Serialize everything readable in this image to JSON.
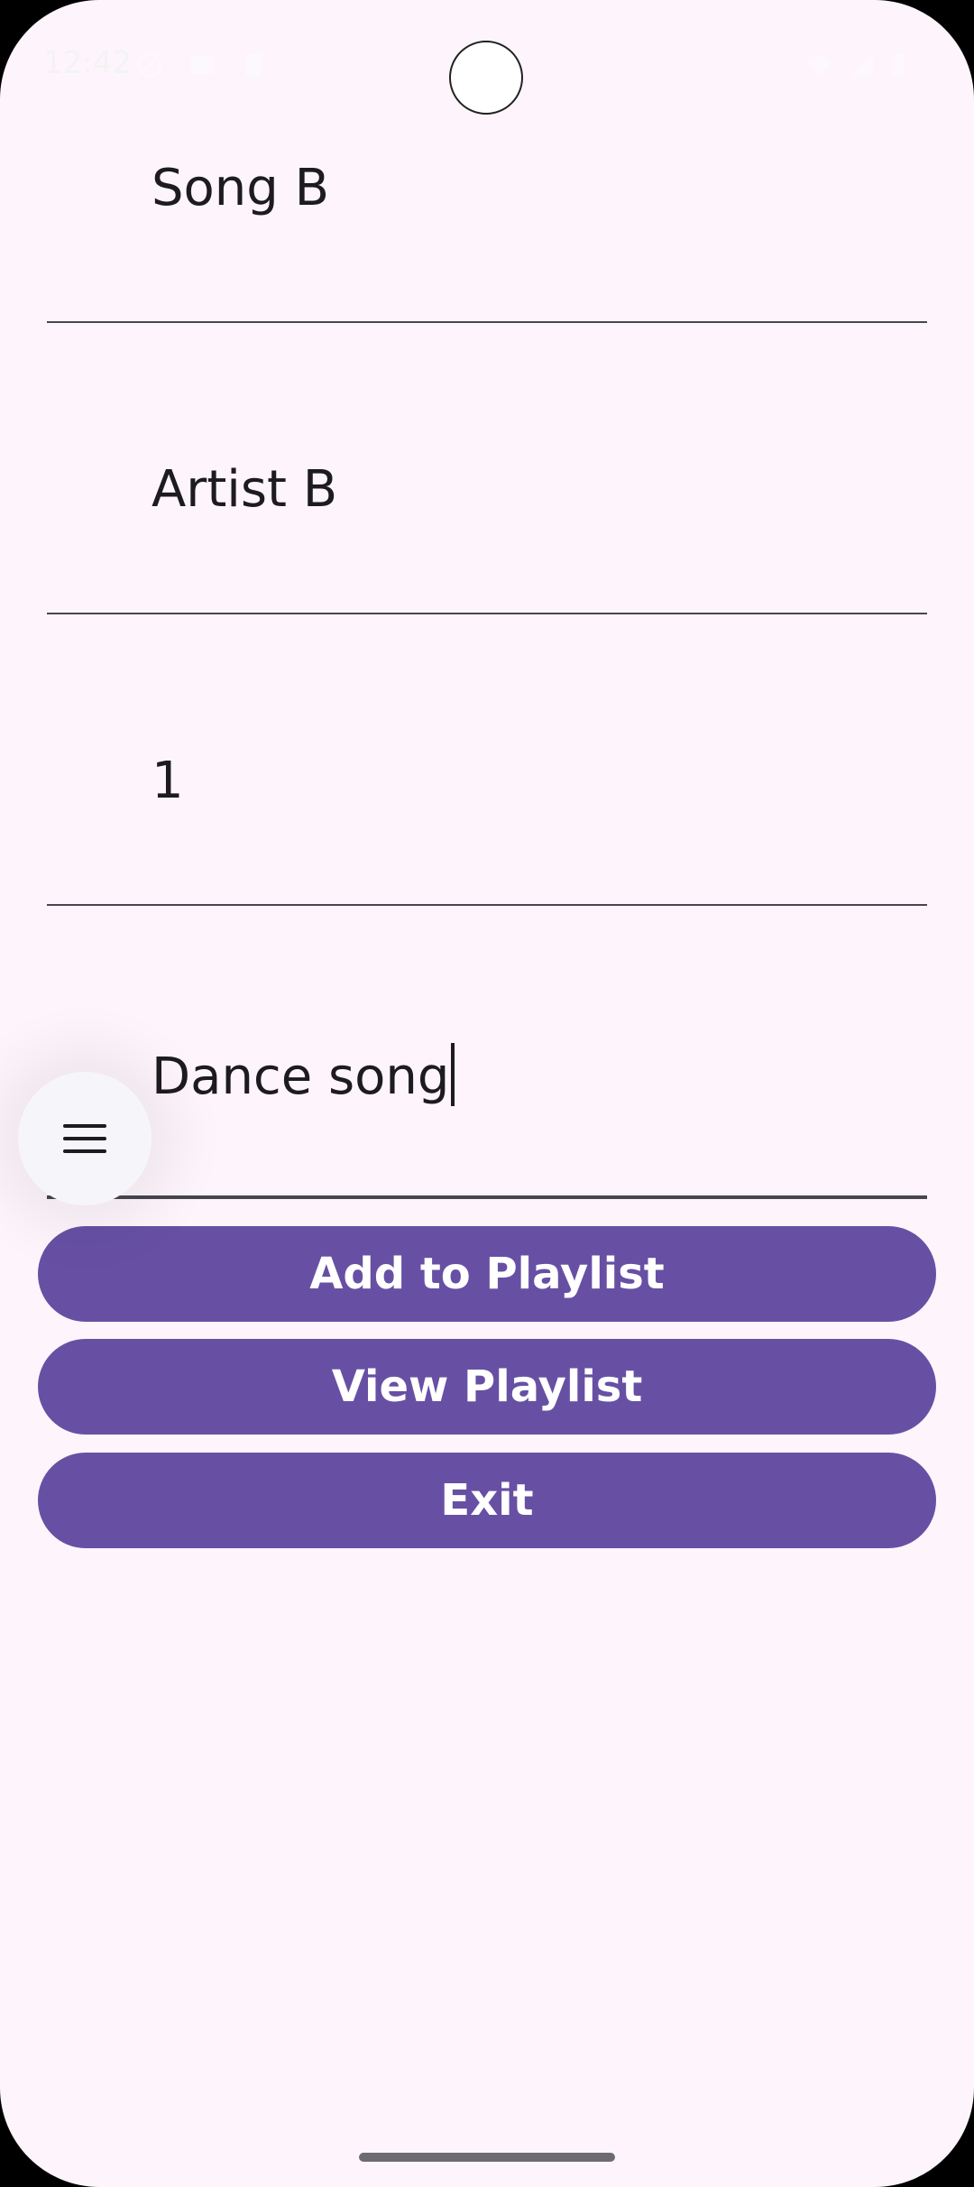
{
  "status_bar": {
    "time": "12:42"
  },
  "form": {
    "song_title": "Song B",
    "artist": "Artist B",
    "rating": "1",
    "comment": "Dance song"
  },
  "buttons": {
    "add_to_playlist": "Add to Playlist",
    "view_playlist": "View Playlist",
    "exit": "Exit"
  },
  "icons": {
    "floating_menu": "hamburger-menu-icon"
  },
  "colors": {
    "background": "#FDF5FB",
    "primary": "#6750A4",
    "on_primary": "#FFFFFF",
    "text": "#1D1B20",
    "divider": "#49454F"
  }
}
